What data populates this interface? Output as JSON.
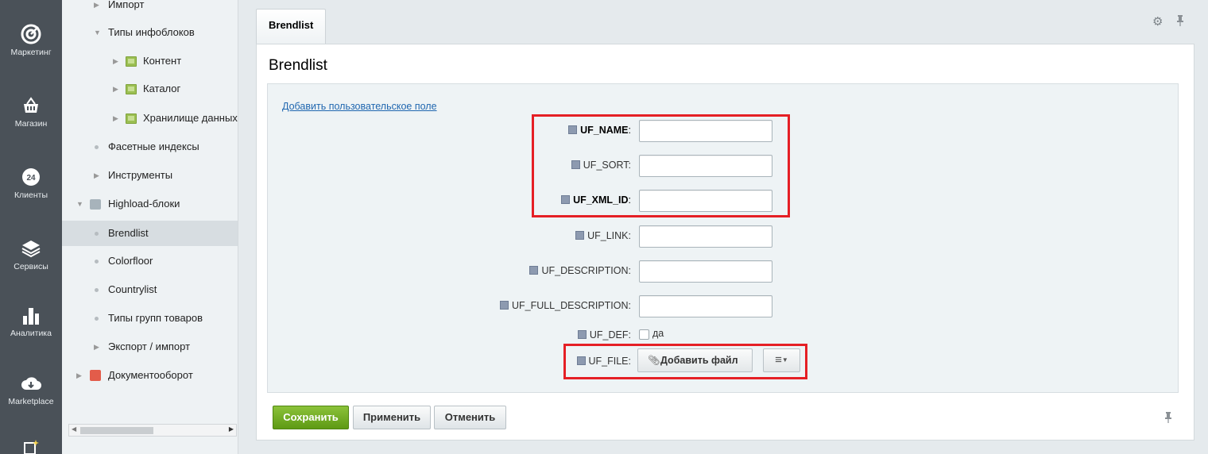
{
  "nav": {
    "items": [
      {
        "label": "Маркетинг",
        "icon": "target-icon"
      },
      {
        "label": "Магазин",
        "icon": "basket-icon"
      },
      {
        "label": "Клиенты",
        "icon": "clients-24-icon"
      },
      {
        "label": "Сервисы",
        "icon": "layers-icon"
      },
      {
        "label": "Аналитика",
        "icon": "bar-chart-icon"
      },
      {
        "label": "Marketplace",
        "icon": "cloud-download-icon"
      }
    ]
  },
  "tree": {
    "items": [
      {
        "label": "Импорт"
      },
      {
        "label": "Типы инфоблоков"
      },
      {
        "label": "Контент"
      },
      {
        "label": "Каталог"
      },
      {
        "label": "Хранилище данных"
      },
      {
        "label": "Фасетные индексы"
      },
      {
        "label": "Инструменты"
      },
      {
        "label": "Highload-блоки"
      },
      {
        "label": "Brendlist"
      },
      {
        "label": "Colorfloor"
      },
      {
        "label": "Countrylist"
      },
      {
        "label": "Типы групп товаров"
      },
      {
        "label": "Экспорт / импорт"
      },
      {
        "label": "Документооборот"
      }
    ]
  },
  "tab": {
    "label": "Brendlist"
  },
  "panel": {
    "title": "Brendlist"
  },
  "form": {
    "add_field_link": "Добавить пользовательское поле",
    "fields": [
      {
        "label": "UF_NAME",
        "value": ""
      },
      {
        "label": "UF_SORT",
        "value": ""
      },
      {
        "label": "UF_XML_ID",
        "value": ""
      },
      {
        "label": "UF_LINK",
        "value": ""
      },
      {
        "label": "UF_DESCRIPTION",
        "value": ""
      },
      {
        "label": "UF_FULL_DESCRIPTION",
        "value": ""
      }
    ],
    "uf_def": {
      "label": "UF_DEF",
      "checkbox_label": "да",
      "checked": false
    },
    "uf_file": {
      "label": "UF_FILE",
      "add_file_label": "Добавить файл"
    }
  },
  "buttons": {
    "save": "Сохранить",
    "apply": "Применить",
    "cancel": "Отменить"
  },
  "colors": {
    "highlight": "#e51f25",
    "save": "#6ea620",
    "link": "#2067b0"
  }
}
